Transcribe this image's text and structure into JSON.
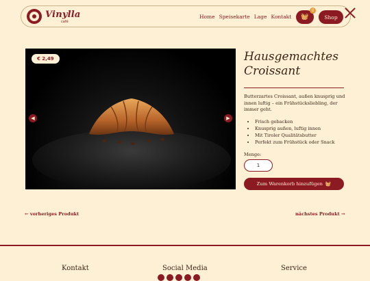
{
  "brand": {
    "logo_text": "Vinylla",
    "logo_sub": "café"
  },
  "nav": {
    "items": [
      "Home",
      "Speisekarte",
      "Lage",
      "Kontakt"
    ],
    "cart_count": "0",
    "shop_label": "Shop"
  },
  "product": {
    "price": "€ 2,49",
    "title": "Hausgemachtes Croissant",
    "description": "Butterzartes Croissant, außen knusprig und innen luftig – ein Frühstücksliebling, der immer geht.",
    "features": [
      "Frisch gebacken",
      "Knusprig außen, luftig innen",
      "Mit Tiroler Qualitätsbutter",
      "Perfekt zum Frühstück oder Snack"
    ],
    "quantity_label": "Menge:",
    "quantity_value": "1",
    "add_to_cart_label": "Zum Warenkorb hinzufügen"
  },
  "pager": {
    "prev": "← vorheriges Produkt",
    "next": "nächstes Produkt →"
  },
  "footer": {
    "contact": "Kontakt",
    "social": "Social Media",
    "service": "Service"
  },
  "colors": {
    "accent": "#8b1a22",
    "background": "#fdf0d5"
  }
}
